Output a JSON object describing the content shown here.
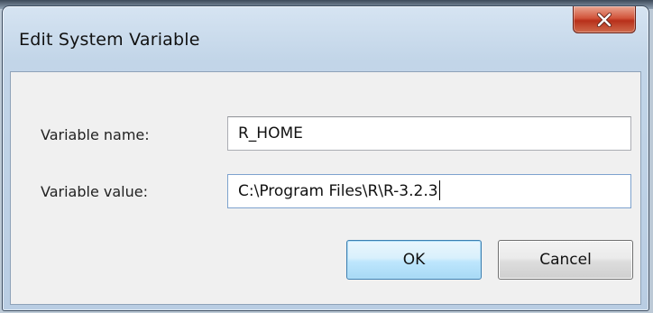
{
  "window": {
    "title": "Edit System Variable",
    "close_icon": "close-icon"
  },
  "form": {
    "name_label": "Variable name:",
    "name_value": "R_HOME",
    "value_label": "Variable value:",
    "value_value": "C:\\Program Files\\R\\R-3.2.3"
  },
  "buttons": {
    "ok_label": "OK",
    "cancel_label": "Cancel"
  },
  "colors": {
    "close_button": "#c8432a",
    "default_button_border": "#3c7fb1",
    "frame": "#b9cde3"
  }
}
